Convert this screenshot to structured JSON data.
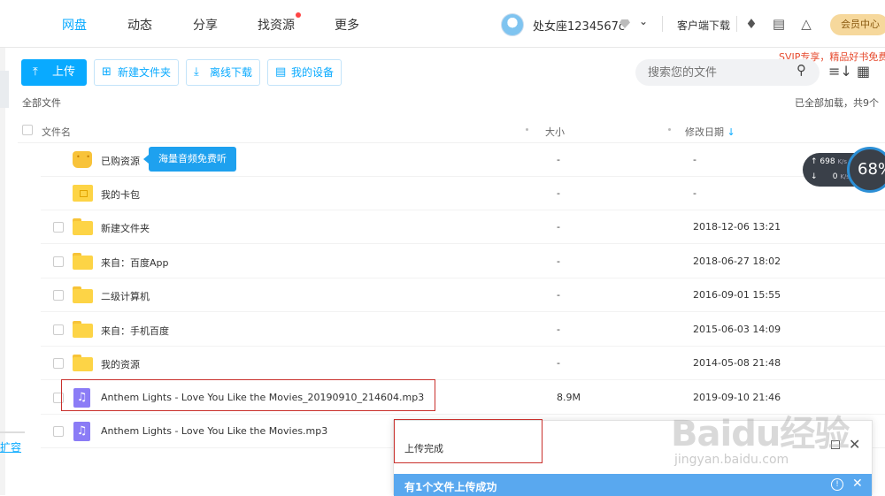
{
  "nav": {
    "items": [
      "网盘",
      "动态",
      "分享",
      "找资源",
      "更多"
    ],
    "username": "处女座1234567c",
    "client_download": "客户端下载",
    "member_center": "会员中心",
    "svip_promo": "SVIP专享，精品好书免费听"
  },
  "toolbar": {
    "upload": "上传",
    "new_folder": "新建文件夹",
    "offline_download": "离线下载",
    "my_devices": "我的设备",
    "search_placeholder": "搜索您的文件"
  },
  "path": {
    "label": "全部文件",
    "loaded_info": "已全部加载，共9个"
  },
  "table": {
    "headers": [
      "文件名",
      "大小",
      "修改日期"
    ],
    "rows": [
      {
        "name": "已购资源",
        "size": "-",
        "date": "-",
        "icon": "bag-icon"
      },
      {
        "name": "我的卡包",
        "size": "-",
        "date": "-",
        "icon": "card-pack-icon"
      },
      {
        "name": "新建文件夹",
        "size": "-",
        "date": "2018-12-06 13:21",
        "icon": "folder-icon"
      },
      {
        "name": "来自：百度App",
        "size": "-",
        "date": "2018-06-27 18:02",
        "icon": "folder-icon"
      },
      {
        "name": "二级计算机",
        "size": "-",
        "date": "2016-09-01 15:55",
        "icon": "folder-icon"
      },
      {
        "name": "来自：手机百度",
        "size": "-",
        "date": "2015-06-03 14:09",
        "icon": "folder-icon"
      },
      {
        "name": "我的资源",
        "size": "-",
        "date": "2014-05-08 21:48",
        "icon": "folder-icon"
      },
      {
        "name": "Anthem Lights - Love You Like the Movies_20190910_214604.mp3",
        "size": "8.9M",
        "date": "2019-09-10 21:46",
        "icon": "music-file-icon"
      },
      {
        "name": "Anthem Lights - Love You Like the Movies.mp3",
        "size": "",
        "date": "",
        "icon": "music-file-icon"
      }
    ],
    "tooltip": "海量音频免费听"
  },
  "speed_widget": {
    "up": "698",
    "up_unit": "K/s",
    "down": "0",
    "down_unit": "K/s",
    "percent": "68%"
  },
  "sidebar": {
    "expand_label": "扩容"
  },
  "upload_panel": {
    "title": "上传完成",
    "message": "有1个文件上传成功"
  },
  "watermark": {
    "main": "Baidu经验",
    "sub": "jingyan.baidu.com"
  },
  "colors": {
    "accent": "#09aaff",
    "folder": "#fdd446",
    "music": "#8b7cf6",
    "highlight_box": "#c9302c"
  }
}
